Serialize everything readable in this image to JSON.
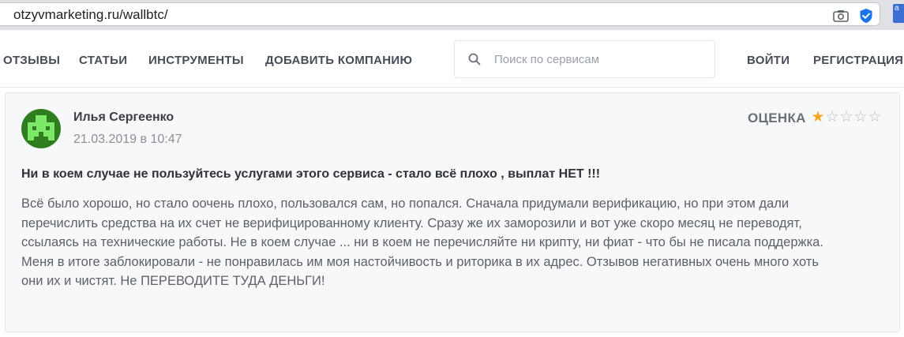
{
  "browser": {
    "url": "otzyvmarketing.ru/wallbtc/",
    "extension_label": "a"
  },
  "nav": {
    "items": [
      "ОТЗЫВЫ",
      "СТАТЬИ",
      "ИНСТРУМЕНТЫ",
      "ДОБАВИТЬ КОМПАНИЮ"
    ],
    "search_placeholder": "Поиск по сервисам",
    "login": "ВОЙТИ",
    "register": "РЕГИСТРАЦИЯ"
  },
  "review": {
    "author": "Илья Сергеенко",
    "date": "21.03.2019 в 10:47",
    "rating_label": "ОЦЕНКА",
    "rating": 1,
    "rating_max": 5,
    "avatar_color": "#2f7d1e",
    "title": "Ни в коем случае не пользуйтесь услугами этого сервиса - стало всё плохо , выплат НЕТ !!!",
    "body_lines": [
      "Всё было хорошо, но стало оочень плохо, пользовался сам, но попался. Сначала придумали верификацию, но при этом дали",
      "перечислить средства на их счет не верифицированному клиенту. Сразу же их заморозили и вот уже скоро месяц не переводят,",
      "ссылаясь на технические работы. Не в коем случае ... ни в коем не перечисляйте ни крипту, ни фиат - что бы не писала поддержка.",
      "Меня в итоге заблокировали - не понравилась им моя настойчивость и риторика в их адрес. Отзывов негативных очень много хоть",
      "они их и чистят. Не ПЕРЕВОДИТЕ ТУДА ДЕНЬГИ!"
    ]
  }
}
